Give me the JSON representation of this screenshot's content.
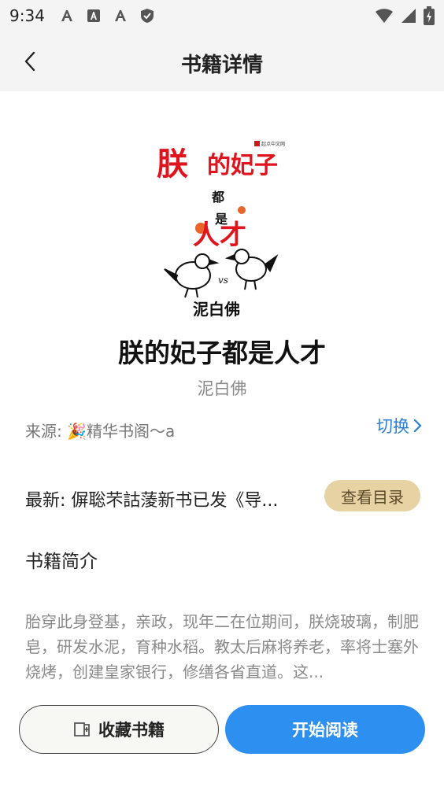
{
  "status": {
    "time": "9:34",
    "left_icons": [
      "a-icon",
      "a-square-icon",
      "a-icon",
      "shield-check-icon"
    ],
    "right_icons": [
      "wifi-icon",
      "signal-icon",
      "battery-icon"
    ]
  },
  "header": {
    "title": "书籍详情",
    "back_icon": "chevron-left-icon"
  },
  "cover": {
    "title_chars_1": "朕",
    "title_chars_2": "的妃子",
    "line_dou": "都",
    "line_shi": "是",
    "line_rencai": "人才",
    "author_mark": "泥白佛",
    "publisher": "起点中文网",
    "vs": "vs"
  },
  "book": {
    "title": "朕的妃子都是人才",
    "author": "泥白佛"
  },
  "source": {
    "label": "来源: 🎉精华书阁～a",
    "switch_label": "切换"
  },
  "latest": {
    "text": "最新: 偋聡芣詁蔆新书已发《导...",
    "toc_label": "查看目录"
  },
  "intro": {
    "heading": "书籍简介",
    "text": "胎穿此身登基，亲政，现年二在位期间，朕烧玻璃，制肥皂，研发水泥，育种水稻。教太后麻将养老，率将士塞外烧烤，创建皇家银行，修缮各省直道。这..."
  },
  "actions": {
    "collect_label": "收藏书籍",
    "read_label": "开始阅读"
  },
  "colors": {
    "accent": "#2d8ff0",
    "link": "#2a7fd6",
    "toc_bg": "#e6d2a2"
  }
}
